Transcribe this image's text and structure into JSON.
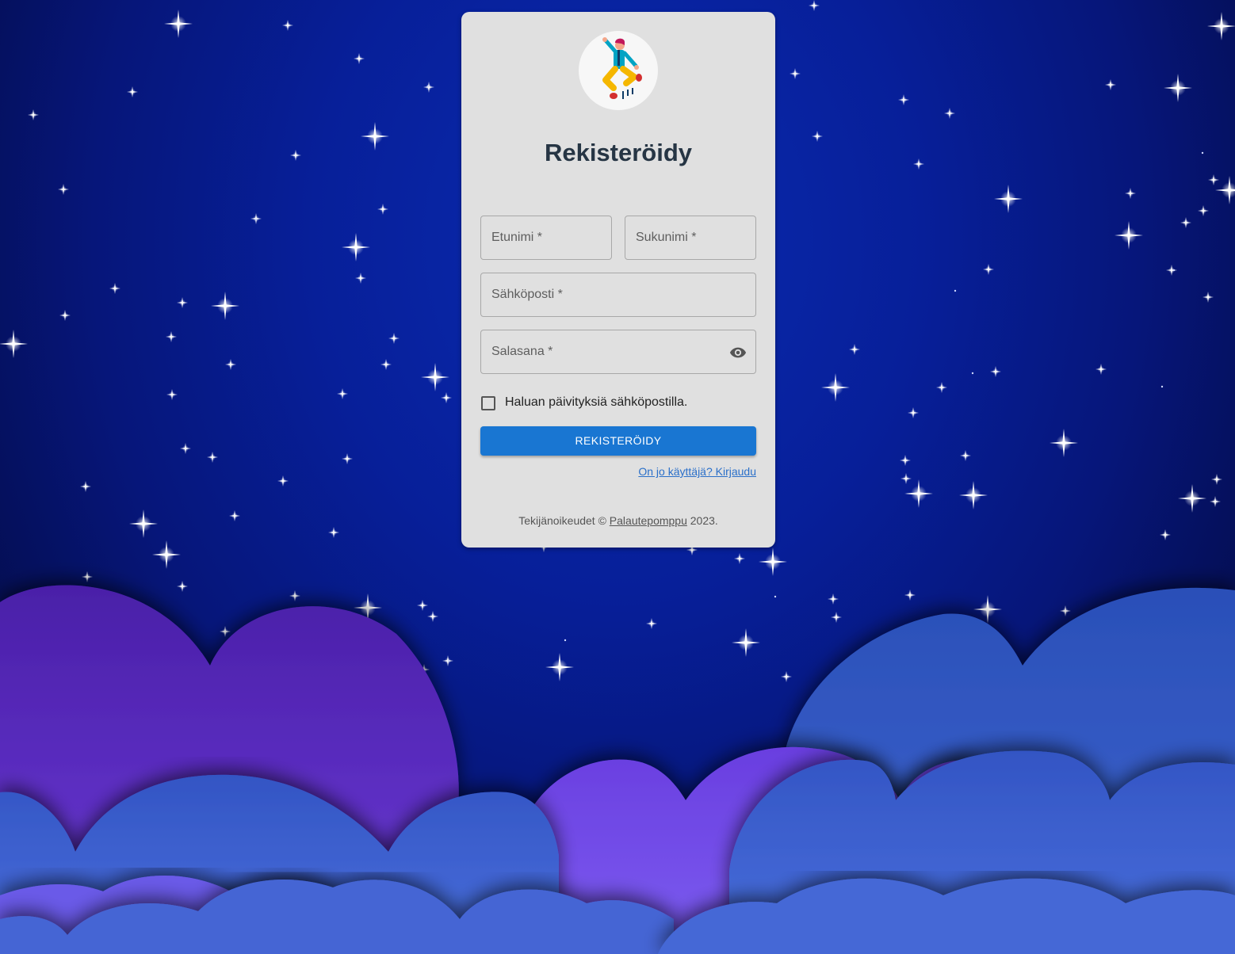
{
  "form": {
    "title": "Rekisteröidy",
    "first_name_label": "Etunimi *",
    "last_name_label": "Sukunimi *",
    "email_label": "Sähköposti *",
    "password_label": "Salasana *",
    "newsletter_label": "Haluan päivityksiä sähköpostilla.",
    "submit_label": "REKISTERÖIDY",
    "login_link": "On jo käyttäjä? Kirjaudu"
  },
  "footer": {
    "prefix": "Tekijänoikeudet © ",
    "brand": "Palautepomppu",
    "suffix": " 2023."
  },
  "icons": {
    "avatar": "jumping-person-illustration",
    "password_toggle": "eye-icon"
  },
  "colors": {
    "accent": "#1976d2",
    "card": "#e0e0e0",
    "sky": "#071f99",
    "title": "#263544"
  }
}
